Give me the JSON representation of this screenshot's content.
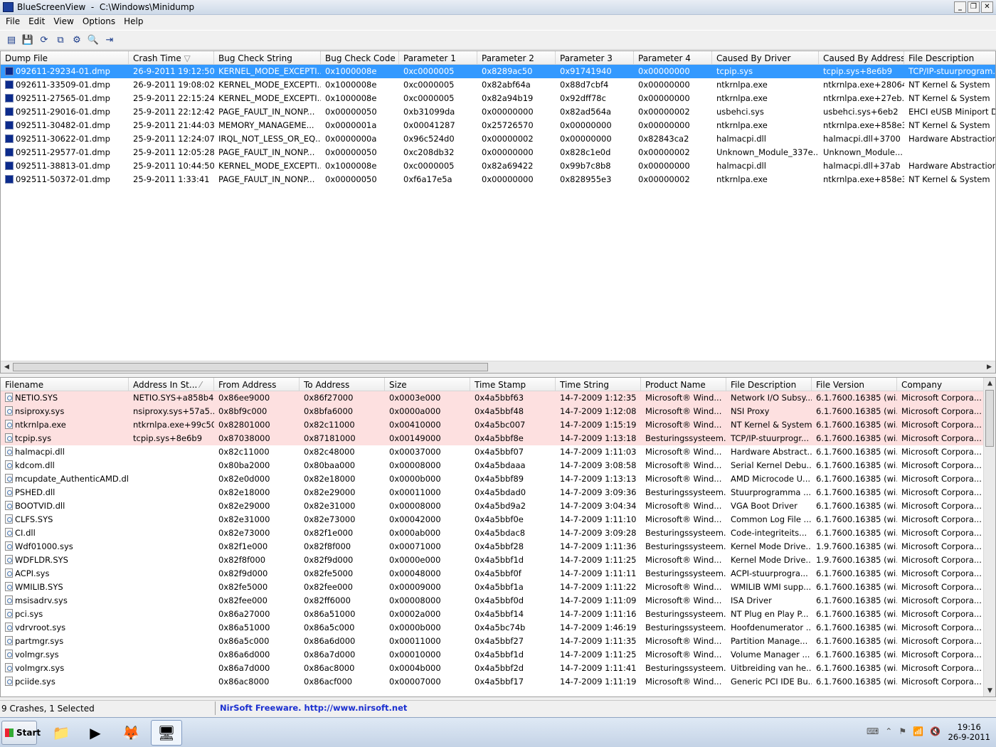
{
  "window": {
    "title": "BlueScreenView",
    "path": "C:\\Windows\\Minidump",
    "minimize": "_",
    "maximize": "❐",
    "close": "✕"
  },
  "menu": [
    "File",
    "Edit",
    "View",
    "Options",
    "Help"
  ],
  "toolbar_icons": [
    "properties-icon",
    "save-icon",
    "refresh-icon",
    "copy-icon",
    "options-icon",
    "find-icon",
    "exit-icon"
  ],
  "crashes": {
    "columns": [
      "Dump File",
      "Crash Time",
      "Bug Check String",
      "Bug Check Code",
      "Parameter 1",
      "Parameter 2",
      "Parameter 3",
      "Parameter 4",
      "Caused By Driver",
      "Caused By Address",
      "File Description"
    ],
    "sort_indicator": "▽",
    "rows": [
      [
        "092611-29234-01.dmp",
        "26-9-2011 19:12:50",
        "KERNEL_MODE_EXCEPTI...",
        "0x1000008e",
        "0xc0000005",
        "0x8289ac50",
        "0x91741940",
        "0x00000000",
        "tcpip.sys",
        "tcpip.sys+8e6b9",
        "TCP/IP-stuurprogram..."
      ],
      [
        "092611-33509-01.dmp",
        "26-9-2011 19:08:02",
        "KERNEL_MODE_EXCEPTI...",
        "0x1000008e",
        "0xc0000005",
        "0x82abf64a",
        "0x88d7cbf4",
        "0x00000000",
        "ntkrnlpa.exe",
        "ntkrnlpa.exe+28064a",
        "NT Kernel & System"
      ],
      [
        "092511-27565-01.dmp",
        "25-9-2011 22:15:24",
        "KERNEL_MODE_EXCEPTI...",
        "0x1000008e",
        "0xc0000005",
        "0x82a94b19",
        "0x92dff78c",
        "0x00000000",
        "ntkrnlpa.exe",
        "ntkrnlpa.exe+27eb...",
        "NT Kernel & System"
      ],
      [
        "092511-29016-01.dmp",
        "25-9-2011 22:12:42",
        "PAGE_FAULT_IN_NONP...",
        "0x00000050",
        "0xb31099da",
        "0x00000000",
        "0x82ad564a",
        "0x00000002",
        "usbehci.sys",
        "usbehci.sys+6eb2",
        "EHCI eUSB Miniport D..."
      ],
      [
        "092511-30482-01.dmp",
        "25-9-2011 21:44:03",
        "MEMORY_MANAGEME...",
        "0x0000001a",
        "0x00041287",
        "0x25726570",
        "0x00000000",
        "0x00000000",
        "ntkrnlpa.exe",
        "ntkrnlpa.exe+858e3",
        "NT Kernel & System"
      ],
      [
        "092511-30622-01.dmp",
        "25-9-2011 12:24:07",
        "IRQL_NOT_LESS_OR_EQ...",
        "0x0000000a",
        "0x96c524d0",
        "0x00000002",
        "0x00000000",
        "0x82843ca2",
        "halmacpi.dll",
        "halmacpi.dll+3700",
        "Hardware Abstraction ..."
      ],
      [
        "092511-29577-01.dmp",
        "25-9-2011 12:05:28",
        "PAGE_FAULT_IN_NONP...",
        "0x00000050",
        "0xc208db32",
        "0x00000000",
        "0x828c1e0d",
        "0x00000002",
        "Unknown_Module_337e...",
        "Unknown_Module...",
        ""
      ],
      [
        "092511-38813-01.dmp",
        "25-9-2011 10:44:50",
        "KERNEL_MODE_EXCEPTI...",
        "0x1000008e",
        "0xc0000005",
        "0x82a69422",
        "0x99b7c8b8",
        "0x00000000",
        "halmacpi.dll",
        "halmacpi.dll+37ab",
        "Hardware Abstraction ..."
      ],
      [
        "092511-50372-01.dmp",
        "25-9-2011 1:33:41",
        "PAGE_FAULT_IN_NONP...",
        "0x00000050",
        "0xf6a17e5a",
        "0x00000000",
        "0x828955e3",
        "0x00000002",
        "ntkrnlpa.exe",
        "ntkrnlpa.exe+858e3",
        "NT Kernel & System"
      ]
    ]
  },
  "drivers": {
    "columns": [
      "Filename",
      "Address In St...",
      "From Address",
      "To Address",
      "Size",
      "Time Stamp",
      "Time String",
      "Product Name",
      "File Description",
      "File Version",
      "Company"
    ],
    "sort_indicator": "⁄",
    "rows": [
      [
        "NETIO.SYS",
        "NETIO.SYS+a858b4c",
        "0x86ee9000",
        "0x86f27000",
        "0x0003e000",
        "0x4a5bbf63",
        "14-7-2009 1:12:35",
        "Microsoft® Wind...",
        "Network I/O Subsy...",
        "6.1.7600.16385 (wi...",
        "Microsoft Corpora..."
      ],
      [
        "nsiproxy.sys",
        "nsiproxy.sys+57a5...",
        "0x8bf9c000",
        "0x8bfa6000",
        "0x0000a000",
        "0x4a5bbf48",
        "14-7-2009 1:12:08",
        "Microsoft® Wind...",
        "NSI Proxy",
        "6.1.7600.16385 (wi...",
        "Microsoft Corpora..."
      ],
      [
        "ntkrnlpa.exe",
        "ntkrnlpa.exe+99c50",
        "0x82801000",
        "0x82c11000",
        "0x00410000",
        "0x4a5bc007",
        "14-7-2009 1:15:19",
        "Microsoft® Wind...",
        "NT Kernel & System",
        "6.1.7600.16385 (wi...",
        "Microsoft Corpora..."
      ],
      [
        "tcpip.sys",
        "tcpip.sys+8e6b9",
        "0x87038000",
        "0x87181000",
        "0x00149000",
        "0x4a5bbf8e",
        "14-7-2009 1:13:18",
        "Besturingssysteem...",
        "TCP/IP-stuurprogr...",
        "6.1.7600.16385 (wi...",
        "Microsoft Corpora..."
      ],
      [
        "halmacpi.dll",
        "",
        "0x82c11000",
        "0x82c48000",
        "0x00037000",
        "0x4a5bbf07",
        "14-7-2009 1:11:03",
        "Microsoft® Wind...",
        "Hardware Abstract...",
        "6.1.7600.16385 (wi...",
        "Microsoft Corpora..."
      ],
      [
        "kdcom.dll",
        "",
        "0x80ba2000",
        "0x80baa000",
        "0x00008000",
        "0x4a5bdaaa",
        "14-7-2009 3:08:58",
        "Microsoft® Wind...",
        "Serial Kernel Debu...",
        "6.1.7600.16385 (wi...",
        "Microsoft Corpora..."
      ],
      [
        "mcupdate_AuthenticAMD.dll",
        "",
        "0x82e0d000",
        "0x82e18000",
        "0x0000b000",
        "0x4a5bbf89",
        "14-7-2009 1:13:13",
        "Microsoft® Wind...",
        "AMD Microcode U...",
        "6.1.7600.16385 (wi...",
        "Microsoft Corpora..."
      ],
      [
        "PSHED.dll",
        "",
        "0x82e18000",
        "0x82e29000",
        "0x00011000",
        "0x4a5bdad0",
        "14-7-2009 3:09:36",
        "Besturingssysteem...",
        "Stuurprogramma ...",
        "6.1.7600.16385 (wi...",
        "Microsoft Corpora..."
      ],
      [
        "BOOTVID.dll",
        "",
        "0x82e29000",
        "0x82e31000",
        "0x00008000",
        "0x4a5bd9a2",
        "14-7-2009 3:04:34",
        "Microsoft® Wind...",
        "VGA Boot Driver",
        "6.1.7600.16385 (wi...",
        "Microsoft Corpora..."
      ],
      [
        "CLFS.SYS",
        "",
        "0x82e31000",
        "0x82e73000",
        "0x00042000",
        "0x4a5bbf0e",
        "14-7-2009 1:11:10",
        "Microsoft® Wind...",
        "Common Log File ...",
        "6.1.7600.16385 (wi...",
        "Microsoft Corpora..."
      ],
      [
        "CI.dll",
        "",
        "0x82e73000",
        "0x82f1e000",
        "0x000ab000",
        "0x4a5bdac8",
        "14-7-2009 3:09:28",
        "Besturingssysteem...",
        "Code-integriteits...",
        "6.1.7600.16385 (wi...",
        "Microsoft Corpora..."
      ],
      [
        "Wdf01000.sys",
        "",
        "0x82f1e000",
        "0x82f8f000",
        "0x00071000",
        "0x4a5bbf28",
        "14-7-2009 1:11:36",
        "Besturingssysteem...",
        "Kernel Mode Drive...",
        "1.9.7600.16385 (wi...",
        "Microsoft Corpora..."
      ],
      [
        "WDFLDR.SYS",
        "",
        "0x82f8f000",
        "0x82f9d000",
        "0x0000e000",
        "0x4a5bbf1d",
        "14-7-2009 1:11:25",
        "Microsoft® Wind...",
        "Kernel Mode Drive...",
        "1.9.7600.16385 (wi...",
        "Microsoft Corpora..."
      ],
      [
        "ACPI.sys",
        "",
        "0x82f9d000",
        "0x82fe5000",
        "0x00048000",
        "0x4a5bbf0f",
        "14-7-2009 1:11:11",
        "Besturingssysteem...",
        "ACPI-stuurprogra...",
        "6.1.7600.16385 (wi...",
        "Microsoft Corpora..."
      ],
      [
        "WMILIB.SYS",
        "",
        "0x82fe5000",
        "0x82fee000",
        "0x00009000",
        "0x4a5bbf1a",
        "14-7-2009 1:11:22",
        "Microsoft® Wind...",
        "WMILIB WMI supp...",
        "6.1.7600.16385 (wi...",
        "Microsoft Corpora..."
      ],
      [
        "msisadrv.sys",
        "",
        "0x82fee000",
        "0x82ff6000",
        "0x00008000",
        "0x4a5bbf0d",
        "14-7-2009 1:11:09",
        "Microsoft® Wind...",
        "ISA Driver",
        "6.1.7600.16385 (wi...",
        "Microsoft Corpora..."
      ],
      [
        "pci.sys",
        "",
        "0x86a27000",
        "0x86a51000",
        "0x0002a000",
        "0x4a5bbf14",
        "14-7-2009 1:11:16",
        "Besturingssysteem...",
        "NT Plug en Play P...",
        "6.1.7600.16385 (wi...",
        "Microsoft Corpora..."
      ],
      [
        "vdrvroot.sys",
        "",
        "0x86a51000",
        "0x86a5c000",
        "0x0000b000",
        "0x4a5bc74b",
        "14-7-2009 1:46:19",
        "Besturingssysteem...",
        "Hoofdenumerator ...",
        "6.1.7600.16385 (wi...",
        "Microsoft Corpora..."
      ],
      [
        "partmgr.sys",
        "",
        "0x86a5c000",
        "0x86a6d000",
        "0x00011000",
        "0x4a5bbf27",
        "14-7-2009 1:11:35",
        "Microsoft® Wind...",
        "Partition Manage...",
        "6.1.7600.16385 (wi...",
        "Microsoft Corpora..."
      ],
      [
        "volmgr.sys",
        "",
        "0x86a6d000",
        "0x86a7d000",
        "0x00010000",
        "0x4a5bbf1d",
        "14-7-2009 1:11:25",
        "Microsoft® Wind...",
        "Volume Manager ...",
        "6.1.7600.16385 (wi...",
        "Microsoft Corpora..."
      ],
      [
        "volmgrx.sys",
        "",
        "0x86a7d000",
        "0x86ac8000",
        "0x0004b000",
        "0x4a5bbf2d",
        "14-7-2009 1:11:41",
        "Besturingssysteem...",
        "Uitbreiding van he...",
        "6.1.7600.16385 (wi...",
        "Microsoft Corpora..."
      ],
      [
        "pciide.sys",
        "",
        "0x86ac8000",
        "0x86acf000",
        "0x00007000",
        "0x4a5bbf17",
        "14-7-2009 1:11:19",
        "Microsoft® Wind...",
        "Generic PCI IDE Bu...",
        "6.1.7600.16385 (wi...",
        "Microsoft Corpora..."
      ]
    ]
  },
  "status": {
    "count": "9 Crashes, 1 Selected",
    "credit": "NirSoft Freeware.  http://www.nirsoft.net"
  },
  "taskbar": {
    "start": "Start",
    "time": "19:16",
    "date": "26-9-2011",
    "apps": [
      "explorer-icon",
      "media-player-icon",
      "firefox-icon",
      "bluescreenview-icon"
    ]
  }
}
